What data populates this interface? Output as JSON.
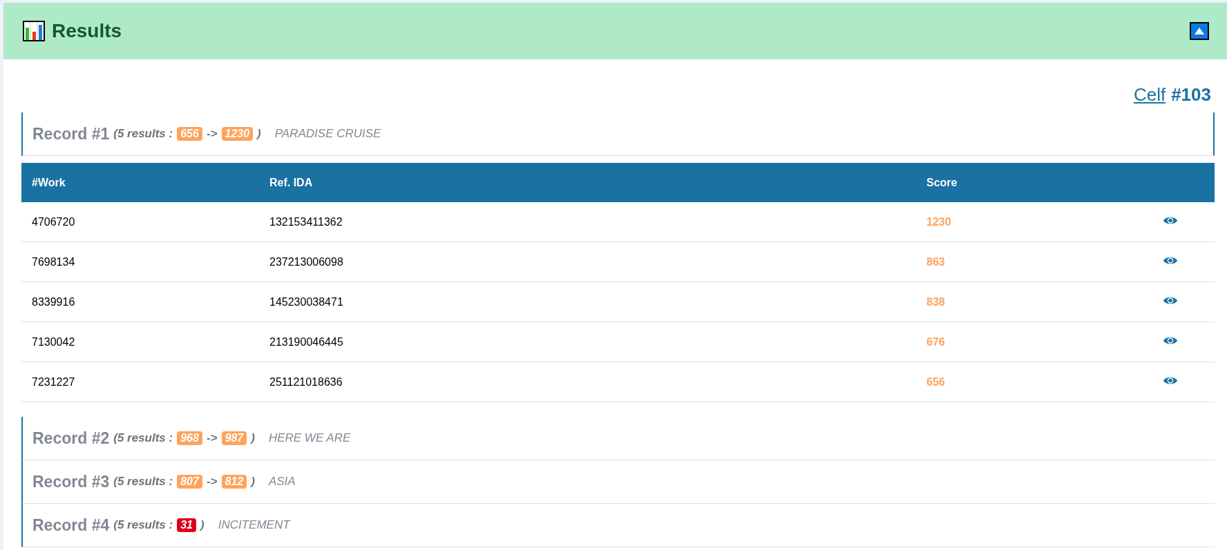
{
  "panel": {
    "title": "Results",
    "collapsed": false
  },
  "reference": {
    "link": "Celf",
    "number": "#103"
  },
  "records": [
    {
      "title": "Record #1",
      "results_label": "(5 results :",
      "arrow": "->",
      "close": ")",
      "name": "PARADISE CRUISE",
      "expanded": true,
      "badges": [
        {
          "text": "656",
          "color": "#ffa35c"
        },
        {
          "text": "1230",
          "color": "#ffa35c"
        }
      ]
    },
    {
      "title": "Record #2",
      "results_label": "(5 results :",
      "arrow": "->",
      "close": ")",
      "name": "HERE WE ARE",
      "expanded": false,
      "badges": [
        {
          "text": "968",
          "color": "#ffa35c"
        },
        {
          "text": "987",
          "color": "#ffa35c"
        }
      ]
    },
    {
      "title": "Record #3",
      "results_label": "(5 results :",
      "arrow": "->",
      "close": ")",
      "name": "ASIA",
      "expanded": false,
      "badges": [
        {
          "text": "807",
          "color": "#ffa35c"
        },
        {
          "text": "812",
          "color": "#ffa35c"
        }
      ]
    },
    {
      "title": "Record #4",
      "results_label": "(5 results :",
      "close": ")",
      "name": "INCITEMENT",
      "expanded": false,
      "badges": [
        {
          "text": "31",
          "color": "#e0001b"
        }
      ]
    }
  ],
  "table": {
    "columns": [
      "#Work",
      "Ref. IDA",
      "Score"
    ],
    "rows": [
      {
        "work": "4706720",
        "ref": "132153411362",
        "score": "1230"
      },
      {
        "work": "7698134",
        "ref": "237213006098",
        "score": "863"
      },
      {
        "work": "8339916",
        "ref": "145230038471",
        "score": "838"
      },
      {
        "work": "7130042",
        "ref": "213190046445",
        "score": "676"
      },
      {
        "work": "7231227",
        "ref": "251121018636",
        "score": "656"
      }
    ]
  }
}
